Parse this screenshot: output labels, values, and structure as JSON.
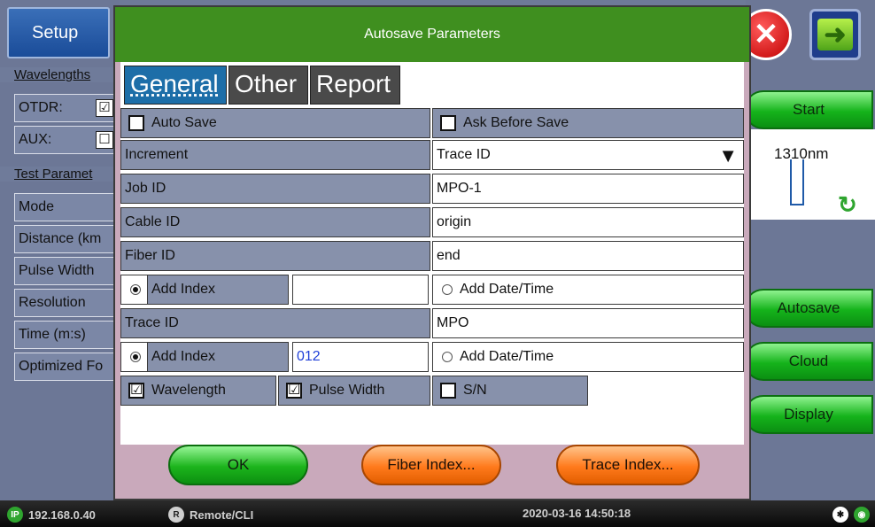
{
  "background": {
    "setup_label": "Setup",
    "wavelengths_heading": "Wavelengths",
    "otdr_label": "OTDR:",
    "otdr_check": "☑",
    "aux_label": "AUX:",
    "aux_check": "☐",
    "test_params_heading": "Test Paramet",
    "rows": [
      "Mode",
      "Distance (km",
      "Pulse Width",
      "Resolution",
      "Time (m:s)",
      "Optimized Fo"
    ],
    "start_label": "Start",
    "wavelength_value": "1310nm",
    "autosave_label": "Autosave",
    "cloud_label": "Cloud",
    "display_label": "Display"
  },
  "status_bar": {
    "ip_badge": "IP",
    "ip": "192.168.0.40",
    "remote_badge": "R",
    "remote": "Remote/CLI",
    "datetime": "2020-03-16  14:50:18"
  },
  "dialog": {
    "title": "Autosave Parameters",
    "tabs": [
      "General",
      "Other",
      "Report"
    ],
    "auto_save_label": "Auto Save",
    "ask_before_save_label": "Ask Before Save",
    "increment_label": "Increment",
    "increment_value": "Trace ID",
    "job_id_label": "Job ID",
    "job_id_value": "MPO-1",
    "cable_id_label": "Cable ID",
    "cable_id_value": "origin",
    "fiber_id_label": "Fiber ID",
    "fiber_id_value": "end",
    "fiber_add_index_label": "Add Index",
    "fiber_add_index_value": "",
    "fiber_add_datetime_label": "Add Date/Time",
    "trace_id_label": "Trace ID",
    "trace_id_value": "MPO",
    "trace_add_index_label": "Add Index",
    "trace_add_index_value": "012",
    "trace_add_datetime_label": "Add Date/Time",
    "wavelength_label": "Wavelength",
    "wavelength_checked": "☑",
    "pulse_width_label": "Pulse Width",
    "pulse_width_checked": "☑",
    "sn_label": "S/N",
    "ok_label": "OK",
    "fiber_index_label": "Fiber Index...",
    "trace_index_label": "Trace Index..."
  }
}
